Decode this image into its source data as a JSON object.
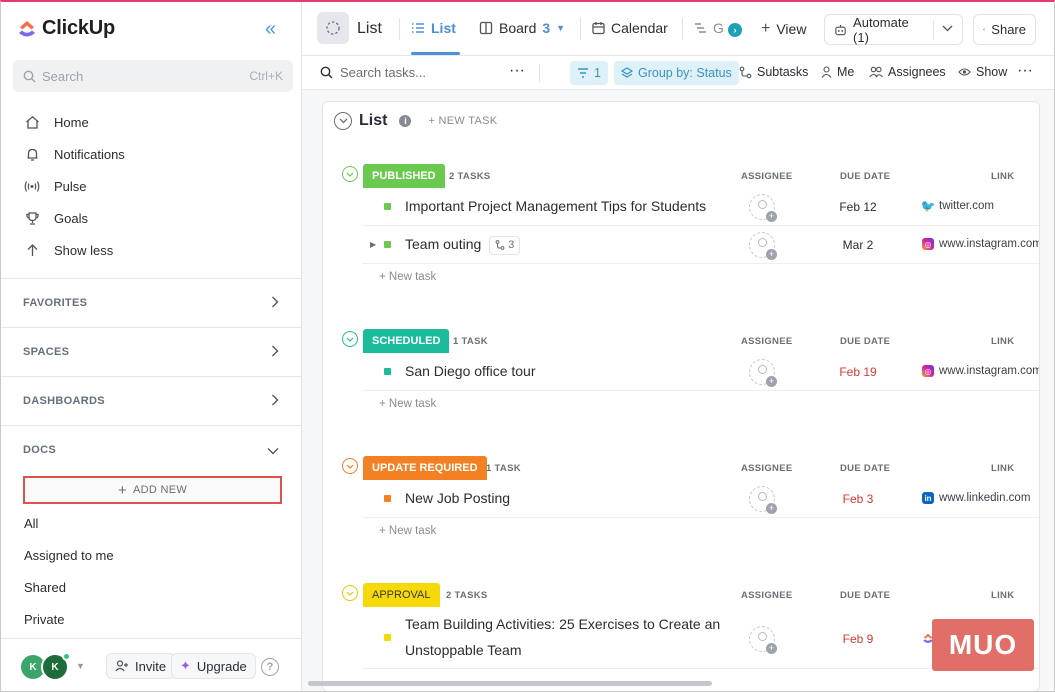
{
  "app": {
    "brand": "ClickUp",
    "search_placeholder": "Search",
    "search_shortcut": "Ctrl+K",
    "nav": [
      {
        "label": "Home",
        "icon": "home-icon"
      },
      {
        "label": "Notifications",
        "icon": "bell-icon"
      },
      {
        "label": "Pulse",
        "icon": "pulse-icon"
      },
      {
        "label": "Goals",
        "icon": "trophy-icon"
      },
      {
        "label": "Show less",
        "icon": "arrow-up-icon"
      }
    ],
    "sections": {
      "favorites": "FAVORITES",
      "spaces": "SPACES",
      "dashboards": "DASHBOARDS",
      "docs": "DOCS"
    },
    "add_new": "ADD NEW",
    "docs_items": [
      "All",
      "Assigned to me",
      "Shared",
      "Private"
    ],
    "avatars": [
      "K",
      "K"
    ],
    "invite": "Invite",
    "upgrade": "Upgrade",
    "help": "?"
  },
  "header": {
    "list_title": "List",
    "tabs": {
      "list": "List",
      "board": "Board",
      "board_count": "3",
      "calendar": "Calendar",
      "gantt": "G",
      "view": "View"
    },
    "automate": "Automate (1)",
    "share": "Share"
  },
  "toolbar": {
    "search_placeholder": "Search tasks...",
    "filter_count": "1",
    "group_by": "Group by: Status",
    "subtasks": "Subtasks",
    "me": "Me",
    "assignees": "Assignees",
    "show": "Show"
  },
  "board": {
    "title": "List",
    "new_task": "+ NEW TASK",
    "col_assignee": "ASSIGNEE",
    "col_due": "DUE DATE",
    "col_link": "LINK",
    "add_task": "+ New task",
    "groups": [
      {
        "label": "PUBLISHED",
        "count": "2 TASKS",
        "color": "#6bc950",
        "tasks": [
          {
            "name": "Important Project Management Tips for Students",
            "due": "Feb 12",
            "overdue": false,
            "link": "twitter.com",
            "site": "twitter"
          },
          {
            "name": "Team outing",
            "subtasks": "3",
            "due": "Mar 2",
            "overdue": false,
            "link": "www.instagram.com",
            "site": "instagram"
          }
        ]
      },
      {
        "label": "SCHEDULED",
        "count": "1 TASK",
        "color": "#1bbc9c",
        "tasks": [
          {
            "name": "San Diego office tour",
            "due": "Feb 19",
            "overdue": true,
            "link": "www.instagram.com",
            "site": "instagram"
          }
        ]
      },
      {
        "label": "UPDATE REQUIRED",
        "count": "1 TASK",
        "color": "#f48024",
        "tasks": [
          {
            "name": "New Job Posting",
            "due": "Feb 3",
            "overdue": true,
            "link": "www.linkedin.com",
            "site": "linkedin"
          }
        ]
      },
      {
        "label": "APPROVAL",
        "count": "2 TASKS",
        "color": "#f5d90a",
        "tasks": [
          {
            "name_line1": "Team Building Activities: 25 Exercises to Create an",
            "name_line2": "Unstoppable Team",
            "due": "Feb 9",
            "overdue": true,
            "link": "",
            "site": "clickup"
          }
        ]
      }
    ]
  },
  "watermark": "MUO"
}
